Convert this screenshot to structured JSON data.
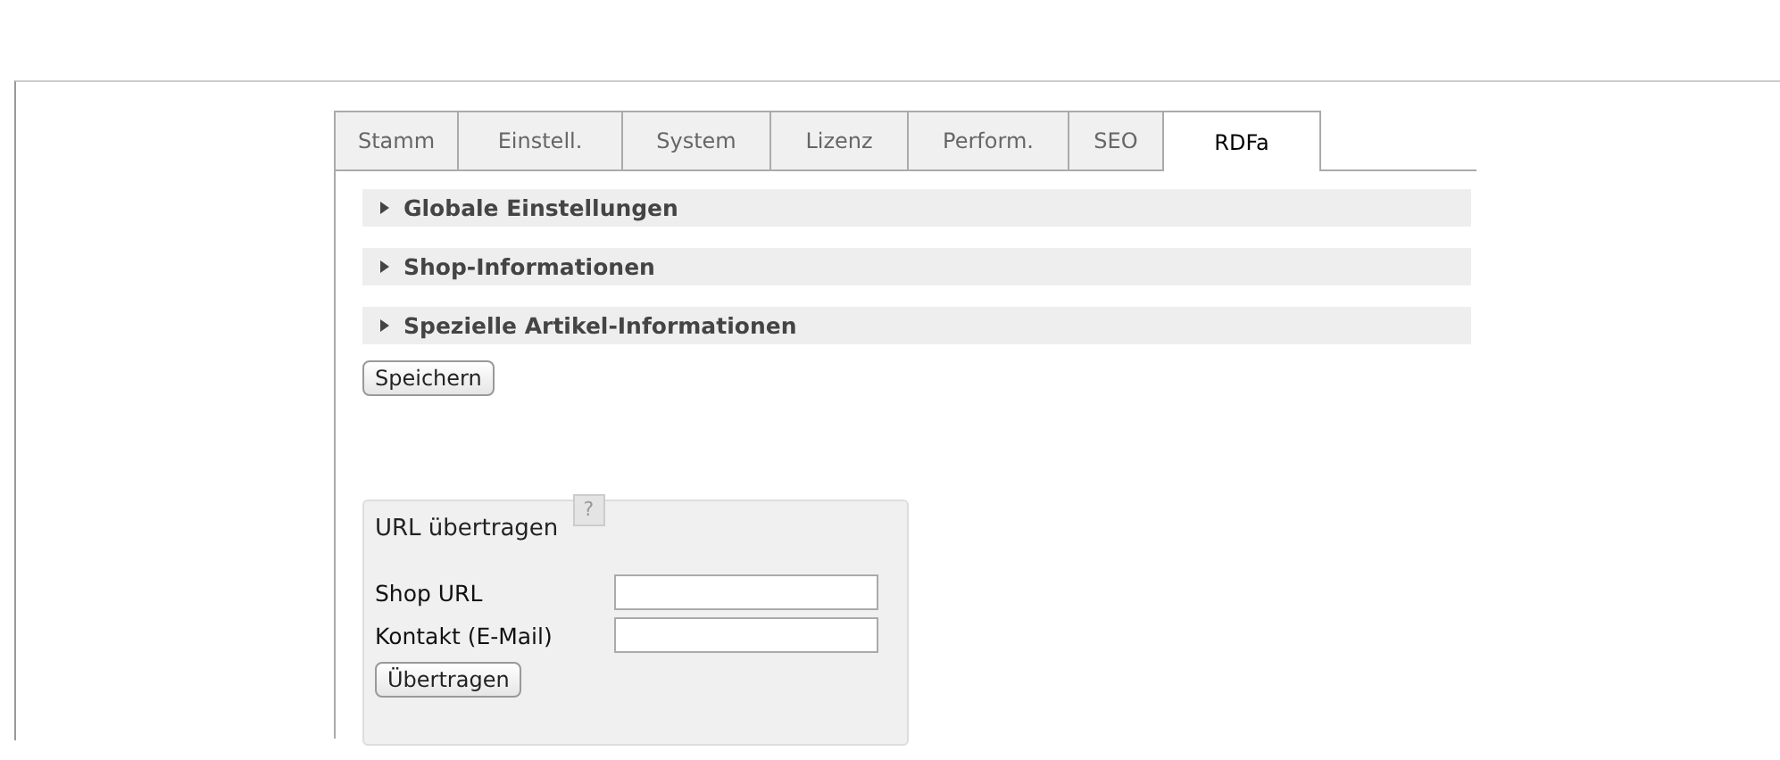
{
  "tabs": [
    {
      "label": "Stamm",
      "selected": false
    },
    {
      "label": "Einstell.",
      "selected": false
    },
    {
      "label": "System",
      "selected": false
    },
    {
      "label": "Lizenz",
      "selected": false
    },
    {
      "label": "Perform.",
      "selected": false
    },
    {
      "label": "SEO",
      "selected": false
    },
    {
      "label": "RDFa",
      "selected": true
    }
  ],
  "sections": [
    {
      "title": "Globale Einstellungen",
      "expanded": false
    },
    {
      "title": "Shop-Informationen",
      "expanded": false
    },
    {
      "title": "Spezielle Artikel-Informationen",
      "expanded": false
    }
  ],
  "save_button": "Speichern",
  "fieldset": {
    "legend": "URL übertragen",
    "help": "?",
    "fields": [
      {
        "label": "Shop URL"
      },
      {
        "label": "Kontakt (E-Mail)"
      }
    ],
    "button": "Übertragen"
  }
}
